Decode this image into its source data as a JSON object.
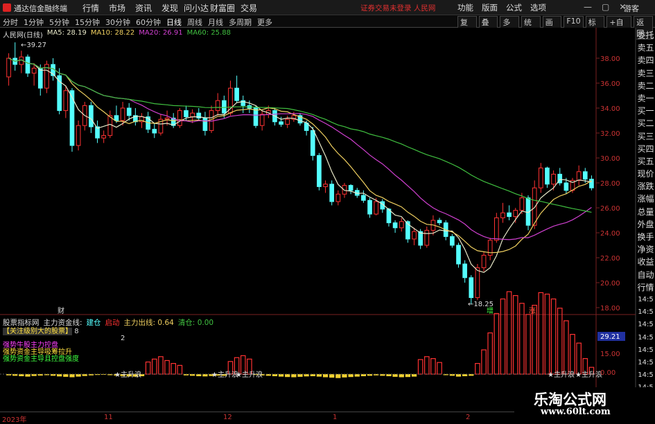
{
  "app": {
    "title": "通达信金融终端",
    "notice": "证券交易未登录  人民网",
    "guest": "游客"
  },
  "menu": [
    "行情",
    "市场",
    "资讯",
    "发现",
    "问小达",
    "财富圈",
    "交易"
  ],
  "right_menu": [
    "功能",
    "版面",
    "公式",
    "选项"
  ],
  "window_controls": [
    "minimize-icon",
    "restore-icon",
    "close-icon"
  ],
  "periods": [
    "分时",
    "1分钟",
    "5分钟",
    "15分钟",
    "30分钟",
    "60分钟",
    "日线",
    "周线",
    "月线",
    "多周期",
    "更多"
  ],
  "active_period": "日线",
  "tools": [
    "复权",
    "叠加",
    "多股",
    "统计",
    "画线",
    "F10",
    "标记",
    "+自选",
    "返回"
  ],
  "right_tabs": [
    "委托",
    "卖五",
    "卖四",
    "卖三",
    "卖二",
    "卖一",
    "买一",
    "买二",
    "买三",
    "买四",
    "买五",
    "现价",
    "涨跌",
    "涨幅",
    "总量",
    "外盘",
    "换手",
    "净资",
    "收益",
    "自动",
    "行情"
  ],
  "right_times": [
    "14:5",
    "14:5",
    "14:5",
    "14:5",
    "14:5",
    "14:5",
    "14:5",
    "14:5"
  ],
  "stock": {
    "name": "人民网(日线)",
    "ma5": "MA5: 28.19",
    "ma10": "MA10: 28.22",
    "ma20": "MA20: 26.91",
    "ma60": "MA60: 25.88"
  },
  "price_axis": [
    "38.00",
    "36.00",
    "34.00",
    "32.00",
    "30.00",
    "28.00",
    "26.00",
    "24.00",
    "22.00",
    "20.00",
    "18.00"
  ],
  "annotations": {
    "high": "39.27",
    "low": "18.25",
    "cai": "财",
    "tag1": "增",
    "tag2": "涨"
  },
  "indicator": {
    "name": "股票指标网",
    "main_fund": "主力资金线:",
    "cyan": "建仓",
    "red": "启动",
    "out": "主力出线: 0.64",
    "green": "清仓: 0.00"
  },
  "ind_text": {
    "line1": "【关注级别大的股票】",
    "line1_value": "8",
    "line2_value": "2",
    "line3": "强势牛股主力控盘",
    "line4": "强势资金主导吸筹拉升",
    "line5": "强势资金主导且控盘强度"
  },
  "ind_axis": {
    "v1": "29.21",
    "v2": "15.00",
    "v3": "0.00"
  },
  "ind_marks": [
    "主升浪",
    "主升浪",
    "主升浪",
    "主升浪",
    "主升浪"
  ],
  "dates": [
    "2023年",
    "11",
    "12",
    "1",
    "2"
  ],
  "watermark": {
    "name": "乐淘公式网",
    "url": "www.60lt.com"
  },
  "colors": {
    "up": "#ff3232",
    "down": "#54ffff",
    "ma5": "#e8e8c8",
    "ma10": "#f0d060",
    "ma20": "#d040d0",
    "ma60": "#40c040"
  },
  "candles": [
    [
      36.5,
      38.4,
      35.8,
      38.0
    ],
    [
      38.0,
      39.27,
      37.0,
      37.5
    ],
    [
      37.5,
      38.6,
      36.8,
      38.1
    ],
    [
      38.1,
      38.3,
      36.5,
      36.8
    ],
    [
      36.8,
      37.6,
      35.8,
      37.2
    ],
    [
      37.2,
      37.5,
      35.0,
      35.6
    ],
    [
      35.6,
      37.8,
      35.2,
      37.5
    ],
    [
      37.5,
      38.0,
      36.2,
      36.6
    ],
    [
      36.6,
      37.2,
      33.5,
      33.8
    ],
    [
      33.8,
      35.8,
      33.2,
      35.4
    ],
    [
      35.4,
      35.6,
      30.5,
      31.0
    ],
    [
      31.0,
      33.0,
      30.6,
      32.6
    ],
    [
      32.6,
      34.5,
      32.2,
      34.2
    ],
    [
      34.2,
      34.5,
      32.0,
      32.5
    ],
    [
      32.5,
      33.0,
      31.2,
      31.6
    ],
    [
      31.6,
      32.2,
      31.2,
      31.8
    ],
    [
      31.8,
      33.8,
      31.6,
      33.4
    ],
    [
      33.4,
      34.2,
      32.8,
      33.0
    ],
    [
      33.0,
      34.5,
      32.6,
      34.0
    ],
    [
      34.0,
      34.4,
      33.0,
      33.4
    ],
    [
      33.4,
      34.0,
      32.6,
      32.9
    ],
    [
      32.9,
      33.6,
      32.4,
      33.3
    ],
    [
      33.3,
      33.7,
      32.0,
      32.3
    ],
    [
      32.3,
      32.8,
      31.6,
      32.0
    ],
    [
      32.0,
      33.5,
      31.8,
      33.1
    ],
    [
      33.1,
      33.8,
      32.6,
      33.2
    ],
    [
      33.2,
      33.6,
      32.4,
      32.6
    ],
    [
      32.6,
      34.0,
      32.4,
      33.8
    ],
    [
      33.8,
      34.2,
      33.0,
      33.3
    ],
    [
      33.3,
      33.9,
      32.8,
      33.6
    ],
    [
      33.6,
      34.0,
      33.0,
      33.2
    ],
    [
      33.2,
      33.7,
      31.8,
      32.2
    ],
    [
      32.2,
      34.2,
      32.0,
      33.8
    ],
    [
      33.8,
      35.2,
      33.4,
      34.6
    ],
    [
      34.6,
      35.0,
      33.2,
      33.6
    ],
    [
      33.6,
      36.2,
      33.4,
      35.6
    ],
    [
      35.6,
      36.6,
      34.4,
      34.6
    ],
    [
      34.6,
      35.0,
      33.6,
      34.2
    ],
    [
      34.2,
      34.6,
      33.6,
      34.0
    ],
    [
      34.0,
      34.2,
      32.4,
      32.6
    ],
    [
      32.6,
      33.8,
      32.2,
      33.5
    ],
    [
      33.5,
      34.2,
      33.2,
      33.8
    ],
    [
      33.8,
      34.0,
      32.6,
      32.9
    ],
    [
      32.9,
      33.3,
      32.5,
      32.7
    ],
    [
      32.7,
      33.4,
      32.4,
      33.1
    ],
    [
      33.1,
      33.7,
      32.9,
      33.4
    ],
    [
      33.4,
      33.6,
      32.6,
      32.8
    ],
    [
      32.8,
      33.0,
      31.8,
      32.2
    ],
    [
      32.2,
      32.5,
      29.8,
      30.2
    ],
    [
      30.2,
      30.4,
      27.4,
      27.7
    ],
    [
      27.7,
      28.2,
      27.2,
      27.9
    ],
    [
      27.9,
      28.2,
      26.2,
      26.5
    ],
    [
      26.5,
      27.4,
      26.2,
      27.1
    ],
    [
      27.1,
      28.0,
      26.8,
      27.8
    ],
    [
      27.8,
      27.9,
      27.1,
      27.4
    ],
    [
      27.4,
      27.6,
      26.8,
      27.0
    ],
    [
      27.0,
      27.4,
      26.4,
      26.6
    ],
    [
      26.6,
      26.8,
      25.2,
      25.5
    ],
    [
      25.5,
      26.8,
      25.4,
      26.5
    ],
    [
      26.5,
      26.7,
      25.6,
      25.9
    ],
    [
      25.9,
      26.0,
      24.5,
      24.8
    ],
    [
      24.8,
      25.0,
      24.0,
      24.4
    ],
    [
      24.4,
      25.2,
      24.1,
      24.9
    ],
    [
      24.9,
      25.0,
      23.2,
      23.5
    ],
    [
      23.5,
      24.4,
      23.0,
      24.1
    ],
    [
      24.1,
      24.3,
      22.7,
      23.0
    ],
    [
      23.0,
      24.5,
      22.8,
      24.2
    ],
    [
      24.2,
      25.4,
      23.8,
      25.0
    ],
    [
      25.0,
      25.2,
      24.6,
      24.8
    ],
    [
      24.8,
      25.0,
      23.4,
      23.7
    ],
    [
      23.7,
      23.9,
      22.8,
      23.0
    ],
    [
      23.0,
      23.2,
      21.2,
      21.5
    ],
    [
      21.5,
      21.8,
      20.0,
      20.4
    ],
    [
      20.4,
      20.6,
      18.25,
      18.8
    ],
    [
      18.8,
      21.5,
      18.6,
      21.2
    ],
    [
      21.2,
      22.5,
      20.9,
      22.2
    ],
    [
      22.2,
      23.6,
      21.8,
      23.4
    ],
    [
      23.4,
      25.6,
      23.2,
      25.2
    ],
    [
      25.2,
      26.4,
      24.8,
      25.6
    ],
    [
      25.6,
      26.2,
      25.0,
      25.3
    ],
    [
      25.3,
      26.0,
      24.8,
      25.8
    ],
    [
      25.8,
      27.2,
      25.5,
      26.8
    ],
    [
      26.8,
      27.0,
      24.2,
      24.6
    ],
    [
      24.6,
      28.2,
      24.3,
      27.6
    ],
    [
      27.6,
      29.6,
      27.2,
      29.2
    ],
    [
      29.2,
      29.3,
      27.6,
      27.9
    ],
    [
      27.9,
      29.0,
      27.4,
      28.7
    ],
    [
      28.7,
      29.2,
      27.8,
      28.0
    ],
    [
      28.0,
      28.4,
      27.1,
      27.4
    ],
    [
      27.4,
      28.4,
      27.2,
      28.2
    ],
    [
      28.2,
      29.4,
      27.8,
      28.9
    ],
    [
      28.9,
      29.2,
      28.0,
      28.3
    ],
    [
      28.3,
      28.6,
      27.4,
      27.6
    ]
  ],
  "ind_values": [
    -0.6,
    -0.8,
    -1.0,
    -1.2,
    -0.9,
    -0.7,
    -0.5,
    -0.8,
    -1.1,
    -1.3,
    -1.5,
    -1.2,
    -0.9,
    -0.6,
    -0.4,
    -0.3,
    -0.5,
    -0.7,
    -0.9,
    -1.1,
    -1.2,
    -1.0,
    2.5,
    3.1,
    3.6,
    2.8,
    2.2,
    1.8,
    -0.6,
    -0.8,
    -1.0,
    -1.1,
    -0.9,
    -0.7,
    -0.8,
    2.6,
    3.4,
    3.8,
    3.1,
    -0.4,
    -0.6,
    -0.8,
    -1.0,
    -1.2,
    -1.4,
    -1.5,
    -1.3,
    -1.1,
    -1.0,
    -1.2,
    -1.5,
    -1.7,
    -1.9,
    -1.6,
    -1.4,
    -1.2,
    -1.0,
    -0.8,
    -0.6,
    -0.8,
    -1.0,
    -1.3,
    -1.5,
    -1.4,
    -1.2,
    3.0,
    3.6,
    3.2,
    2.4,
    -0.5,
    -0.8,
    -1.2,
    -1.0,
    -0.8,
    2.2,
    5.0,
    8.5,
    12.5,
    15.5,
    17.0,
    16.2,
    14.6,
    12.3,
    14.2,
    16.8,
    16.5,
    15.5,
    13.6,
    11.0,
    8.2,
    6.4,
    3.2,
    1.4
  ]
}
